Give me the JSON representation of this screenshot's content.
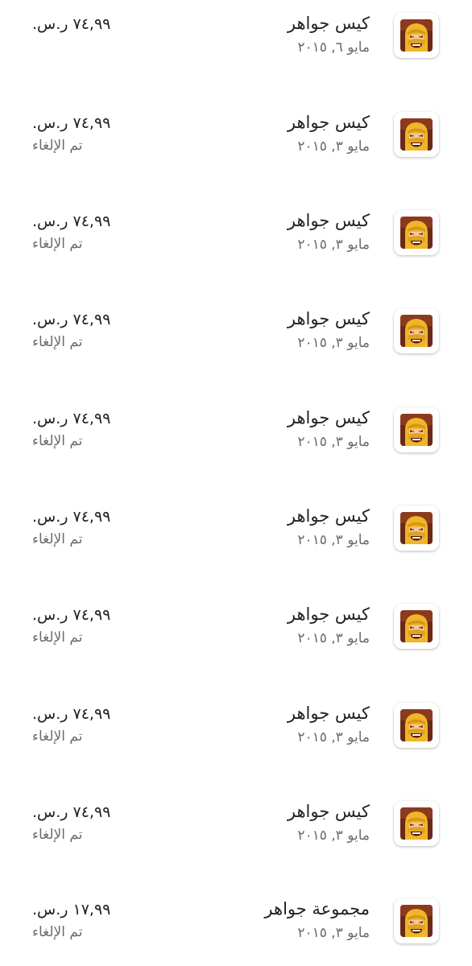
{
  "purchases": [
    {
      "icon": "clash-of-clans-barbarian-icon",
      "title": "كيس جواهر",
      "date": "مايو ٦, ٢٠١٥",
      "price": "٧٤,٩٩ ر.س.",
      "status": ""
    },
    {
      "icon": "clash-of-clans-barbarian-icon",
      "title": "كيس جواهر",
      "date": "مايو ٣, ٢٠١٥",
      "price": "٧٤,٩٩ ر.س.",
      "status": "تم الإلغاء"
    },
    {
      "icon": "clash-of-clans-barbarian-icon",
      "title": "كيس جواهر",
      "date": "مايو ٣, ٢٠١٥",
      "price": "٧٤,٩٩ ر.س.",
      "status": "تم الإلغاء"
    },
    {
      "icon": "clash-of-clans-barbarian-icon",
      "title": "كيس جواهر",
      "date": "مايو ٣, ٢٠١٥",
      "price": "٧٤,٩٩ ر.س.",
      "status": "تم الإلغاء"
    },
    {
      "icon": "clash-of-clans-barbarian-icon",
      "title": "كيس جواهر",
      "date": "مايو ٣, ٢٠١٥",
      "price": "٧٤,٩٩ ر.س.",
      "status": "تم الإلغاء"
    },
    {
      "icon": "clash-of-clans-barbarian-icon",
      "title": "كيس جواهر",
      "date": "مايو ٣, ٢٠١٥",
      "price": "٧٤,٩٩ ر.س.",
      "status": "تم الإلغاء"
    },
    {
      "icon": "clash-of-clans-barbarian-icon",
      "title": "كيس جواهر",
      "date": "مايو ٣, ٢٠١٥",
      "price": "٧٤,٩٩ ر.س.",
      "status": "تم الإلغاء"
    },
    {
      "icon": "clash-of-clans-barbarian-icon",
      "title": "كيس جواهر",
      "date": "مايو ٣, ٢٠١٥",
      "price": "٧٤,٩٩ ر.س.",
      "status": "تم الإلغاء"
    },
    {
      "icon": "clash-of-clans-barbarian-icon",
      "title": "كيس جواهر",
      "date": "مايو ٣, ٢٠١٥",
      "price": "٧٤,٩٩ ر.س.",
      "status": "تم الإلغاء"
    },
    {
      "icon": "clash-of-clans-barbarian-icon",
      "title": "مجموعة جواهر",
      "date": "مايو ٣, ٢٠١٥",
      "price": "١٧,٩٩ ر.س.",
      "status": "تم الإلغاء"
    }
  ],
  "colors": {
    "primary_text": "#222222",
    "secondary_text": "#6b6b6b",
    "background": "#ffffff"
  }
}
